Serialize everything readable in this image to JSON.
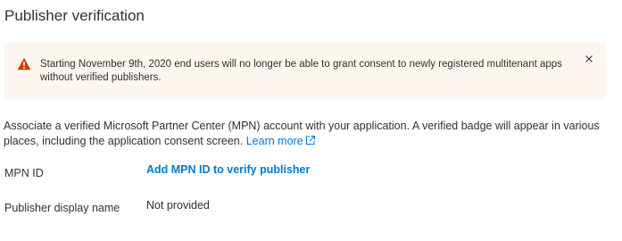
{
  "page": {
    "title": "Publisher verification"
  },
  "banner": {
    "icon": "warning-icon",
    "message": "Starting November 9th, 2020 end users will no longer be able to grant consent to newly registered multitenant apps without verified publishers.",
    "close_icon": "close-icon",
    "background_color": "#fdf6f0",
    "icon_color": "#d83b01"
  },
  "description": {
    "text": "Associate a verified Microsoft Partner Center (MPN) account with your application. A verified badge will appear in various places, including the application consent screen.",
    "learn_more_label": "Learn more",
    "learn_more_icon": "external-link-icon"
  },
  "fields": {
    "mpn_id": {
      "label": "MPN ID",
      "action_label": "Add MPN ID to verify publisher"
    },
    "publisher_display_name": {
      "label": "Publisher display name",
      "value": "Not provided"
    }
  },
  "colors": {
    "link": "#0078d4",
    "text": "#323130"
  }
}
